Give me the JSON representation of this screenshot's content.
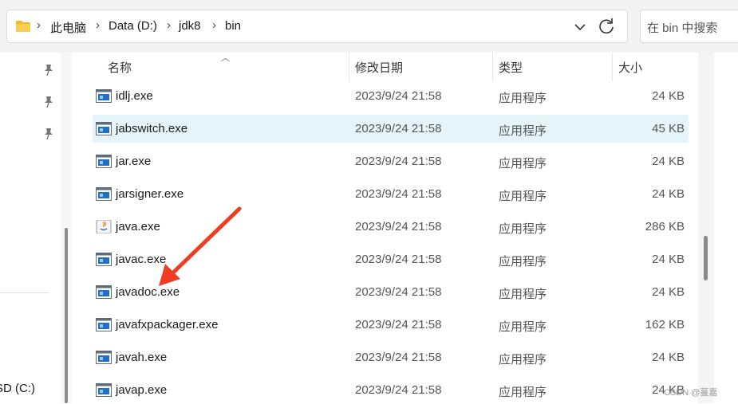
{
  "address_bar": {
    "crumbs": [
      "此电脑",
      "Data (D:)",
      "jdk8",
      "bin"
    ],
    "separator": "›"
  },
  "search": {
    "placeholder": "在 bin 中搜索"
  },
  "nav": {
    "drive_label": "SD (C:)"
  },
  "columns": {
    "name": "名称",
    "date": "修改日期",
    "type": "类型",
    "size": "大小"
  },
  "files": [
    {
      "name": "idlj.exe",
      "date": "2023/9/24 21:58",
      "type": "应用程序",
      "size": "24 KB",
      "icon": "exe-icon"
    },
    {
      "name": "jabswitch.exe",
      "date": "2023/9/24 21:58",
      "type": "应用程序",
      "size": "45 KB",
      "icon": "exe-icon",
      "selected": true
    },
    {
      "name": "jar.exe",
      "date": "2023/9/24 21:58",
      "type": "应用程序",
      "size": "24 KB",
      "icon": "exe-icon"
    },
    {
      "name": "jarsigner.exe",
      "date": "2023/9/24 21:58",
      "type": "应用程序",
      "size": "24 KB",
      "icon": "exe-icon"
    },
    {
      "name": "java.exe",
      "date": "2023/9/24 21:58",
      "type": "应用程序",
      "size": "286 KB",
      "icon": "java-icon"
    },
    {
      "name": "javac.exe",
      "date": "2023/9/24 21:58",
      "type": "应用程序",
      "size": "24 KB",
      "icon": "exe-icon"
    },
    {
      "name": "javadoc.exe",
      "date": "2023/9/24 21:58",
      "type": "应用程序",
      "size": "24 KB",
      "icon": "exe-icon"
    },
    {
      "name": "javafxpackager.exe",
      "date": "2023/9/24 21:58",
      "type": "应用程序",
      "size": "162 KB",
      "icon": "exe-icon"
    },
    {
      "name": "javah.exe",
      "date": "2023/9/24 21:58",
      "type": "应用程序",
      "size": "24 KB",
      "icon": "exe-icon"
    },
    {
      "name": "javap.exe",
      "date": "2023/9/24 21:58",
      "type": "应用程序",
      "size": "24 KB",
      "icon": "exe-icon"
    }
  ],
  "annotation": {
    "color": "#f03c23",
    "target": "javadoc.exe"
  },
  "watermark": "CSDN @蔓嘉",
  "colors": {
    "selected_row": "#e5f3fb",
    "folder": "#f2b92d",
    "exe_blue": "#1f6fc5"
  }
}
